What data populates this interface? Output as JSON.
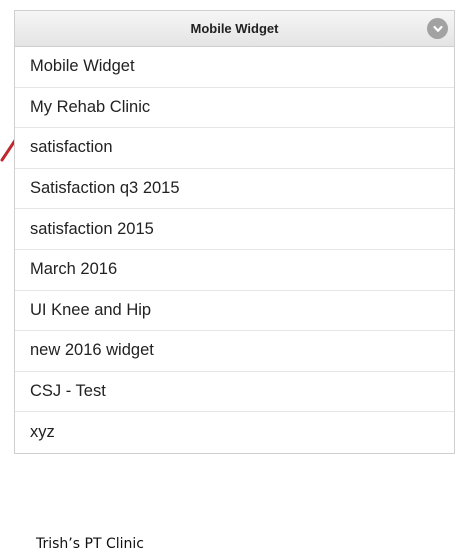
{
  "dropdown": {
    "selected_label": "Mobile Widget",
    "options": [
      "Mobile Widget",
      "My Rehab Clinic",
      "satisfaction",
      "Satisfaction q3 2015",
      "satisfaction 2015",
      "March 2016",
      "UI Knee and Hip",
      "new 2016 widget",
      "CSJ - Test",
      "xyz"
    ]
  },
  "caption": "Trish’s PT Clinic",
  "colors": {
    "arrow": "#c0282d",
    "chevron_bg": "#a2a2a2"
  },
  "icons": {
    "dropdown_toggle": "chevron-down-icon",
    "annotation": "arrow-icon"
  }
}
